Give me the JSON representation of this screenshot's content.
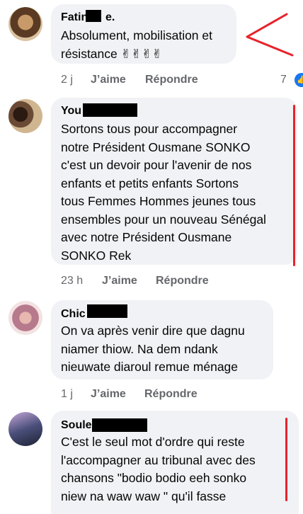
{
  "comments": [
    {
      "author": "Fatin",
      "author_tail": "e.",
      "text": "Absolument, mobilisation et\nrésistance ✌✌✌✌",
      "time": "2 j",
      "like_label": "J’aime",
      "reply_label": "Répondre",
      "reaction_count": "7"
    },
    {
      "author": "You",
      "text": "Sortons tous pour  accompagner\nnotre Président Ousmane SONKO\nc'est un devoir pour l'avenir de nos\nenfants et petits enfants Sortons\ntous Femmes Hommes  jeunes tous\nensembles pour un nouveau Sénégal\navec notre Président Ousmane\nSONKO Rek",
      "time": "23 h",
      "like_label": "J’aime",
      "reply_label": "Répondre"
    },
    {
      "author": "Chic",
      "text": "On va après venir dire que dagnu\nniamer thiow. Na dem ndank\nnieuwate diaroul remue ménage",
      "time": "1 j",
      "like_label": "J’aime",
      "reply_label": "Répondre"
    },
    {
      "author": "Soule",
      "text": "C'est le seul mot d'ordre qui reste\nl'accompagner au tribunal avec des\nchansons \"bodio bodio eeh sonko\nniew na waw waw \" qu'il fasse"
    }
  ],
  "colors": {
    "bubble": "#f0f2f5",
    "secondary_text": "#65676b",
    "annotation_red": "#e8222a",
    "like_blue": "#1877f2"
  },
  "icons": [
    "like-reaction-icon",
    "victory-hand-emoji"
  ]
}
